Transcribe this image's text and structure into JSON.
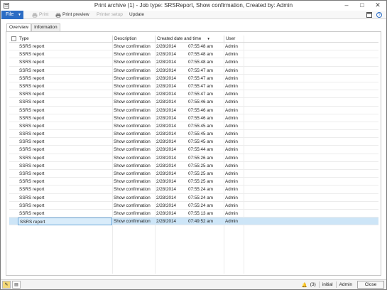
{
  "window": {
    "title": "Print archive (1) - Job type: SRSReport, Show confirmation, Created by: Admin",
    "controls": [
      "–",
      "□",
      "✕"
    ]
  },
  "toolbar": {
    "file_label": "File",
    "items": [
      {
        "label": "Print",
        "icon": "printer-icon",
        "enabled": false
      },
      {
        "label": "Print preview",
        "icon": "print-preview-icon",
        "enabled": true
      },
      {
        "label": "Printer setup",
        "enabled": false
      },
      {
        "label": "Update",
        "enabled": true
      }
    ]
  },
  "tabs": [
    {
      "label": "Overview",
      "active": true
    },
    {
      "label": "Information",
      "active": false
    }
  ],
  "grid": {
    "columns": [
      "Type",
      "Description",
      "Created date and time",
      "User"
    ],
    "sorted_column": "Created date and time",
    "rows": [
      {
        "type": "SSRS report",
        "description": "Show confirmation",
        "date": "2/28/2014",
        "time": "07:55:48 am",
        "user": "Admin"
      },
      {
        "type": "SSRS report",
        "description": "Show confirmation",
        "date": "2/28/2014",
        "time": "07:55:48 am",
        "user": "Admin"
      },
      {
        "type": "SSRS report",
        "description": "Show confirmation",
        "date": "2/28/2014",
        "time": "07:55:48 am",
        "user": "Admin"
      },
      {
        "type": "SSRS report",
        "description": "Show confirmation",
        "date": "2/28/2014",
        "time": "07:55:47 am",
        "user": "Admin"
      },
      {
        "type": "SSRS report",
        "description": "Show confirmation",
        "date": "2/28/2014",
        "time": "07:55:47 am",
        "user": "Admin"
      },
      {
        "type": "SSRS report",
        "description": "Show confirmation",
        "date": "2/28/2014",
        "time": "07:55:47 am",
        "user": "Admin"
      },
      {
        "type": "SSRS report",
        "description": "Show confirmation",
        "date": "2/28/2014",
        "time": "07:55:47 am",
        "user": "Admin"
      },
      {
        "type": "SSRS report",
        "description": "Show confirmation",
        "date": "2/28/2014",
        "time": "07:55:46 am",
        "user": "Admin"
      },
      {
        "type": "SSRS report",
        "description": "Show confirmation",
        "date": "2/28/2014",
        "time": "07:55:46 am",
        "user": "Admin"
      },
      {
        "type": "SSRS report",
        "description": "Show confirmation",
        "date": "2/28/2014",
        "time": "07:55:46 am",
        "user": "Admin"
      },
      {
        "type": "SSRS report",
        "description": "Show confirmation",
        "date": "2/28/2014",
        "time": "07:55:45 am",
        "user": "Admin"
      },
      {
        "type": "SSRS report",
        "description": "Show confirmation",
        "date": "2/28/2014",
        "time": "07:55:45 am",
        "user": "Admin"
      },
      {
        "type": "SSRS report",
        "description": "Show confirmation",
        "date": "2/28/2014",
        "time": "07:55:45 am",
        "user": "Admin"
      },
      {
        "type": "SSRS report",
        "description": "Show confirmation",
        "date": "2/28/2014",
        "time": "07:55:44 am",
        "user": "Admin"
      },
      {
        "type": "SSRS report",
        "description": "Show confirmation",
        "date": "2/28/2014",
        "time": "07:55:26 am",
        "user": "Admin"
      },
      {
        "type": "SSRS report",
        "description": "Show confirmation",
        "date": "2/28/2014",
        "time": "07:55:25 am",
        "user": "Admin"
      },
      {
        "type": "SSRS report",
        "description": "Show confirmation",
        "date": "2/28/2014",
        "time": "07:55:25 am",
        "user": "Admin"
      },
      {
        "type": "SSRS report",
        "description": "Show confirmation",
        "date": "2/28/2014",
        "time": "07:55:25 am",
        "user": "Admin"
      },
      {
        "type": "SSRS report",
        "description": "Show confirmation",
        "date": "2/28/2014",
        "time": "07:55:24 am",
        "user": "Admin"
      },
      {
        "type": "SSRS report",
        "description": "Show confirmation",
        "date": "2/28/2014",
        "time": "07:55:24 am",
        "user": "Admin"
      },
      {
        "type": "SSRS report",
        "description": "Show confirmation",
        "date": "2/28/2014",
        "time": "07:55:24 am",
        "user": "Admin"
      },
      {
        "type": "SSRS report",
        "description": "Show confirmation",
        "date": "2/28/2014",
        "time": "07:55:13 am",
        "user": "Admin"
      },
      {
        "type": "SSRS report",
        "description": "Show confirmation",
        "date": "2/28/2014",
        "time": "07:49:52 am",
        "user": "Admin",
        "selected": true
      }
    ]
  },
  "statusbar": {
    "alerts": "(3)",
    "company": "initial",
    "user": "Admin",
    "close_label": "Close"
  },
  "colors": {
    "file_button": "#2b6cc4",
    "selected_row": "#cde5f7",
    "note_icon": "#f3d97a"
  }
}
